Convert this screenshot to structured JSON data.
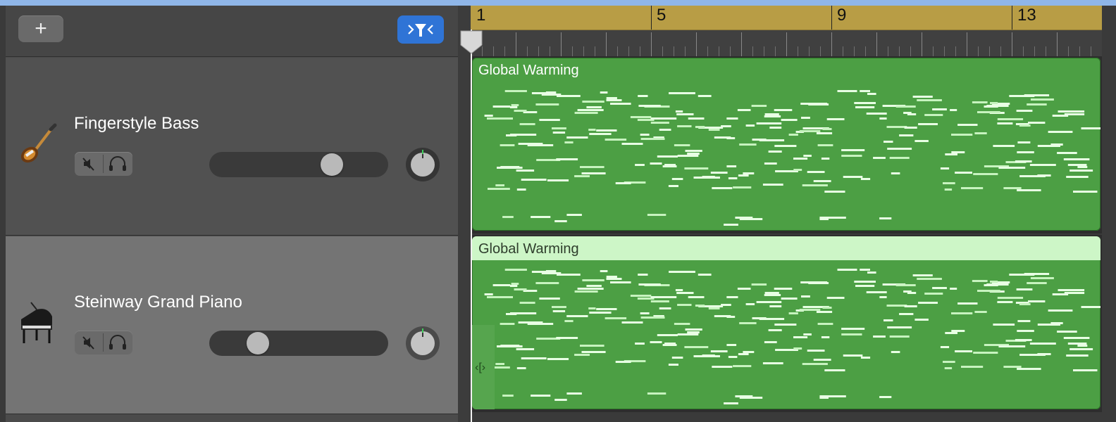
{
  "toolbar": {
    "add_icon": "plus-icon",
    "add_label": "+",
    "filter_icon": "track-filter-icon"
  },
  "ruler": {
    "bars": [
      {
        "label": "1",
        "bar": 1
      },
      {
        "label": "5",
        "bar": 5
      },
      {
        "label": "9",
        "bar": 9
      },
      {
        "label": "13",
        "bar": 13
      }
    ]
  },
  "tracks": [
    {
      "name": "Fingerstyle Bass",
      "icon": "bass-guitar-icon",
      "volume": 0.72,
      "pan": 0.0,
      "region": {
        "title": "Global Warming",
        "selected": false
      },
      "colors": {
        "header": "#515151"
      }
    },
    {
      "name": "Steinway Grand Piano",
      "icon": "grand-piano-icon",
      "volume": 0.23,
      "pan": 0.0,
      "region": {
        "title": "Global Warming",
        "selected": true
      },
      "colors": {
        "header": "#747474"
      }
    }
  ],
  "colors": {
    "region_green": "#4c9f44",
    "region_header_selected": "#cdf6c7",
    "ruler_gold": "#b89d45",
    "accent_blue": "#2f74d6"
  }
}
